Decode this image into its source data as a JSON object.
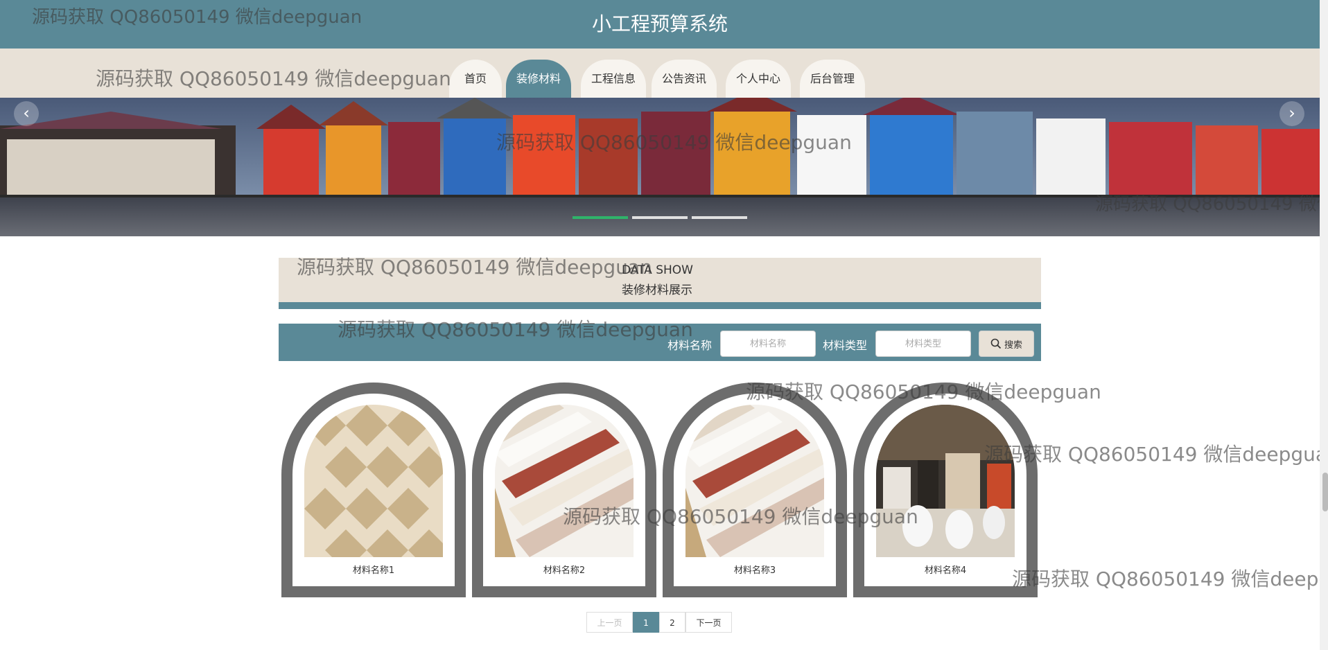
{
  "header": {
    "title": "小工程预算系统"
  },
  "nav": [
    {
      "label": "首页",
      "active": false
    },
    {
      "label": "装修材料",
      "active": true
    },
    {
      "label": "工程信息",
      "active": false
    },
    {
      "label": "公告资讯",
      "active": false
    },
    {
      "label": "个人中心",
      "active": false
    },
    {
      "label": "后台管理",
      "active": false
    }
  ],
  "banner": {
    "prev_icon": "chevron-left-icon",
    "next_icon": "chevron-right-icon",
    "prev": "‹",
    "next": "›",
    "active_dot": 1,
    "dot_count": 3
  },
  "section": {
    "title_en": "DATA SHOW",
    "title_cn": "装修材料展示"
  },
  "search": {
    "name_label": "材料名称",
    "name_placeholder": "材料名称",
    "type_label": "材料类型",
    "type_placeholder": "材料类型",
    "button_label": "搜索",
    "button_icon": "search-icon"
  },
  "materials": [
    {
      "name": "材料名称1"
    },
    {
      "name": "材料名称2"
    },
    {
      "name": "材料名称3"
    },
    {
      "name": "材料名称4"
    }
  ],
  "pagination": {
    "prev": "上一页",
    "pages": [
      "1",
      "2"
    ],
    "current": "1",
    "next": "下一页"
  },
  "watermark": "源码获取 QQ86050149 微信deepguan",
  "colors": {
    "primary": "#5a8997",
    "beige": "#e8e1d7",
    "card_frame": "#6d6d6d",
    "dot_active": "#2fb36a"
  }
}
